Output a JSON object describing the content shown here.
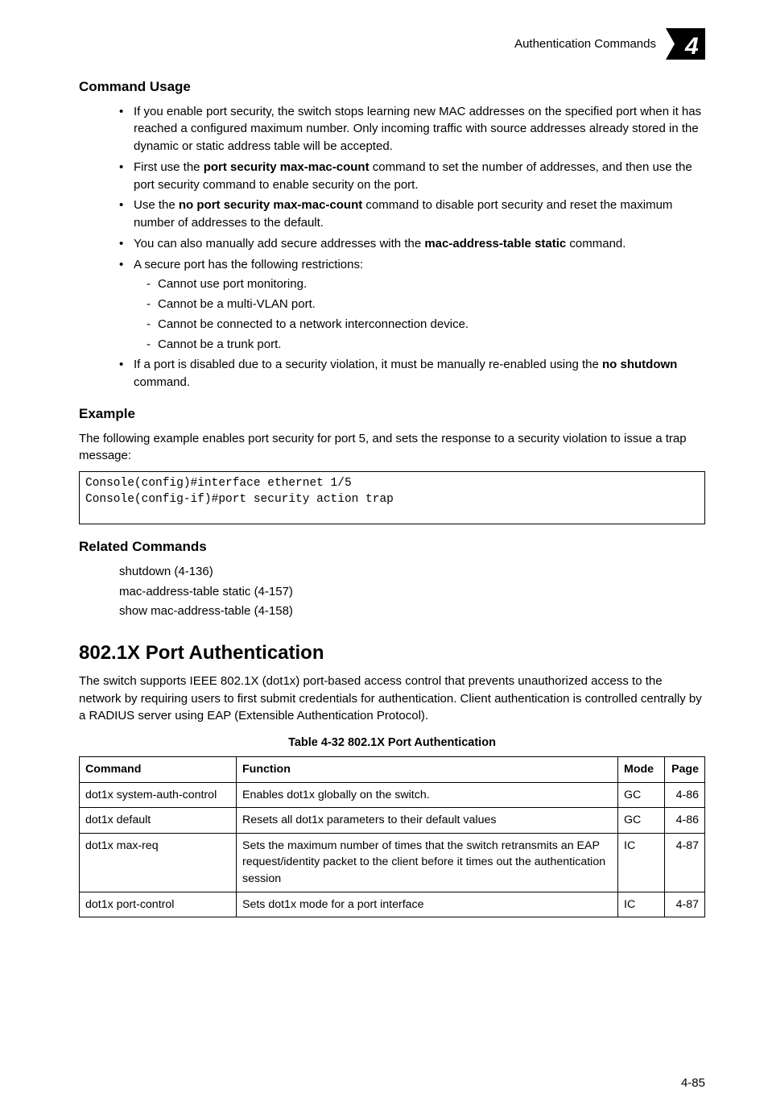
{
  "header": {
    "section": "Authentication Commands",
    "chapter_number": "4"
  },
  "command_usage": {
    "heading": "Command Usage",
    "b1": "If you enable port security, the switch stops learning new MAC addresses on the specified port when it has reached a configured maximum number. Only incoming traffic with source addresses already stored in the dynamic or static address table will be accepted.",
    "b2_pre": "First use the ",
    "b2_cmd": "port security max-mac-count",
    "b2_post": " command to set the number of addresses, and then use the port security command to enable security on the port.",
    "b3_pre": "Use the ",
    "b3_cmd": "no port security max-mac-count",
    "b3_post": " command to disable port security and reset the maximum number of addresses to the default.",
    "b4_pre": "You can also manually add secure addresses with the ",
    "b4_cmd": "mac-address-table static",
    "b4_post": " command.",
    "b5": "A secure port has the following restrictions:",
    "b5_s1": "Cannot use port monitoring.",
    "b5_s2": "Cannot be a multi-VLAN port.",
    "b5_s3": "Cannot be connected to a network interconnection device.",
    "b5_s4": "Cannot be a trunk port.",
    "b6_pre": "If a port is disabled due to a security violation, it must be manually re-enabled using the ",
    "b6_cmd": "no shutdown",
    "b6_post": " command."
  },
  "example": {
    "heading": "Example",
    "intro": "The following example enables port security for port 5, and sets the response to a security violation to issue a trap message:",
    "code": "Console(config)#interface ethernet 1/5\nConsole(config-if)#port security action trap"
  },
  "related": {
    "heading": "Related Commands",
    "l1": "shutdown (4-136)",
    "l2": "mac-address-table static (4-157)",
    "l3": "show mac-address-table (4-158)"
  },
  "section_8021x": {
    "heading": "802.1X Port Authentication",
    "intro": "The switch supports IEEE 802.1X (dot1x) port-based access control that prevents unauthorized access to the network by requiring users to first submit credentials for authentication. Client authentication is controlled centrally by a RADIUS server using EAP (Extensible Authentication Protocol).",
    "table_caption": "Table 4-32  802.1X Port Authentication",
    "table": {
      "headers": {
        "cmd": "Command",
        "func": "Function",
        "mode": "Mode",
        "page": "Page"
      },
      "rows": [
        {
          "cmd": "dot1x system-auth-control",
          "func": "Enables dot1x globally on the switch.",
          "mode": "GC",
          "page": "4-86"
        },
        {
          "cmd": "dot1x default",
          "func": "Resets all dot1x parameters to their default values",
          "mode": "GC",
          "page": "4-86"
        },
        {
          "cmd": "dot1x max-req",
          "func": "Sets the maximum number of times that the switch retransmits an EAP request/identity packet to the client before it times out the authentication session",
          "mode": "IC",
          "page": "4-87"
        },
        {
          "cmd": "dot1x port-control",
          "func": "Sets dot1x mode for a port interface",
          "mode": "IC",
          "page": "4-87"
        }
      ]
    }
  },
  "footer": {
    "page_no": "4-85"
  }
}
